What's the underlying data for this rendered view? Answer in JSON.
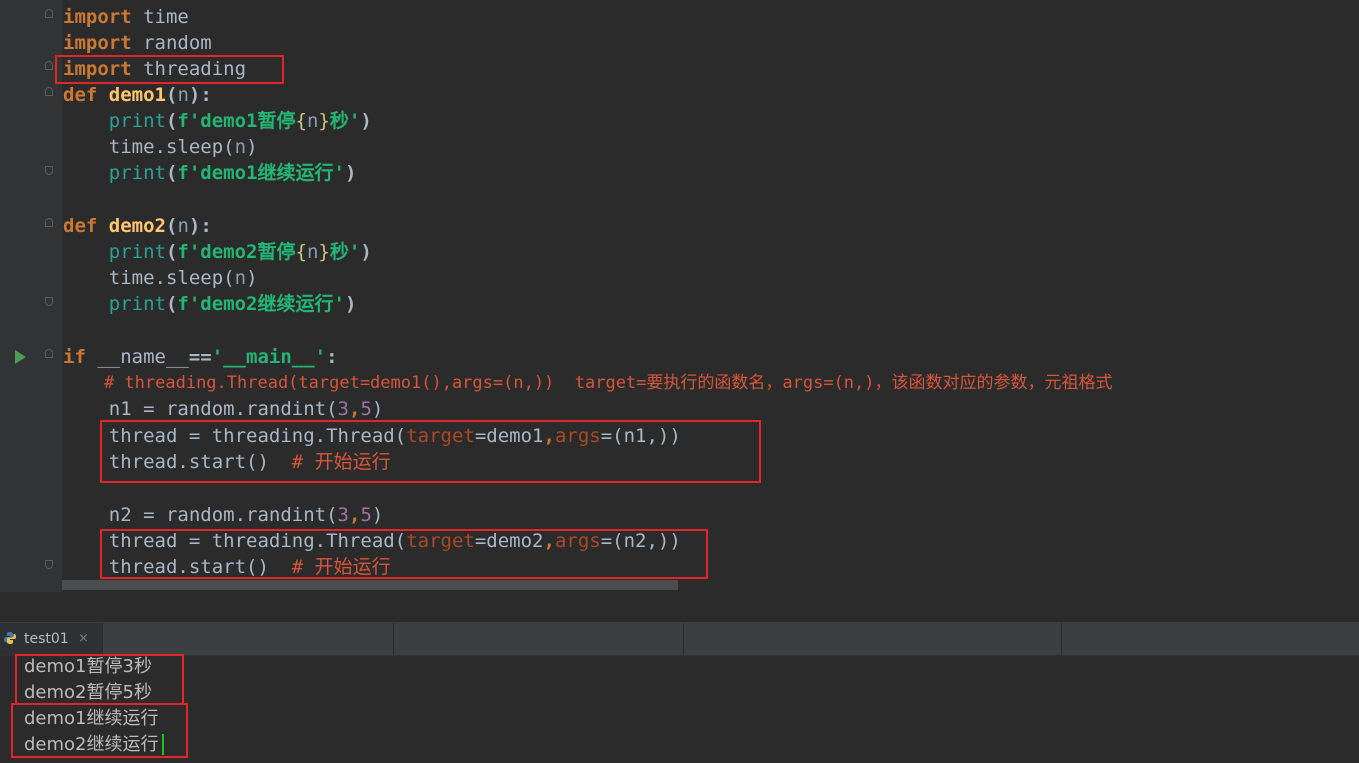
{
  "editor": {
    "lines": {
      "l1": {
        "k": "import",
        "t": " time"
      },
      "l2": {
        "k": "import",
        "t": " random"
      },
      "l3": {
        "k": "import",
        "t": " threading"
      },
      "l4": {
        "k": "def",
        "f": "demo1",
        "p": "n"
      },
      "l5": {
        "pr": "print",
        "fs1": "f'demo1暂停",
        "v": "n",
        "fs2": "秒'"
      },
      "l6": {
        "t": "time.sleep(",
        "p": "n",
        "e": ")"
      },
      "l7": {
        "pr": "print",
        "fs": "f'demo1继续运行'"
      },
      "l9": {
        "k": "def",
        "f": "demo2",
        "p": "n"
      },
      "l10": {
        "pr": "print",
        "fs1": "f'demo2暂停",
        "v": "n",
        "fs2": "秒'"
      },
      "l11": {
        "t": "time.sleep(",
        "p": "n",
        "e": ")"
      },
      "l12": {
        "pr": "print",
        "fs": "f'demo2继续运行'"
      },
      "l14": {
        "k": "if",
        "d": " __name__",
        "op": "==",
        "s": "'__main__'"
      },
      "l15": {
        "c": "# threading.Thread(target=demo1(),args=(n,))  target=要执行的函数名，args=(n,)，该函数对应的参数，元祖格式"
      },
      "l16": {
        "a": "n1 = random.randint(",
        "n1": "3",
        "cm": ",",
        "n2": "5",
        "e": ")"
      },
      "l17": {
        "a": "thread = threading.Thread(",
        "k1": "target",
        "eq": "=",
        "v1": "demo1",
        "cm": ",",
        "k2": "args",
        "eq2": "=",
        "v2": "(n1,))"
      },
      "l18": {
        "a": "thread.start()",
        "c": "  # 开始运行"
      },
      "l20": {
        "a": "n2 = random.randint(",
        "n1": "3",
        "cm": ",",
        "n2": "5",
        "e": ")"
      },
      "l21": {
        "a": "thread = threading.Thread(",
        "k1": "target",
        "eq": "=",
        "v1": "demo2",
        "cm": ",",
        "k2": "args",
        "eq2": "=",
        "v2": "(n2,))"
      },
      "l22": {
        "a": "thread.start()",
        "c": "  # 开始运行"
      }
    }
  },
  "run_panel": {
    "tab_label": "test01",
    "tab_close": "×",
    "output": [
      "demo1暂停3秒",
      "demo2暂停5秒",
      "demo1继续运行",
      "demo2继续运行"
    ]
  },
  "colors": {
    "highlight_box": "#e0262b",
    "background": "#2b2b2b",
    "keyword": "#cc7832",
    "fstring": "#22b573"
  }
}
